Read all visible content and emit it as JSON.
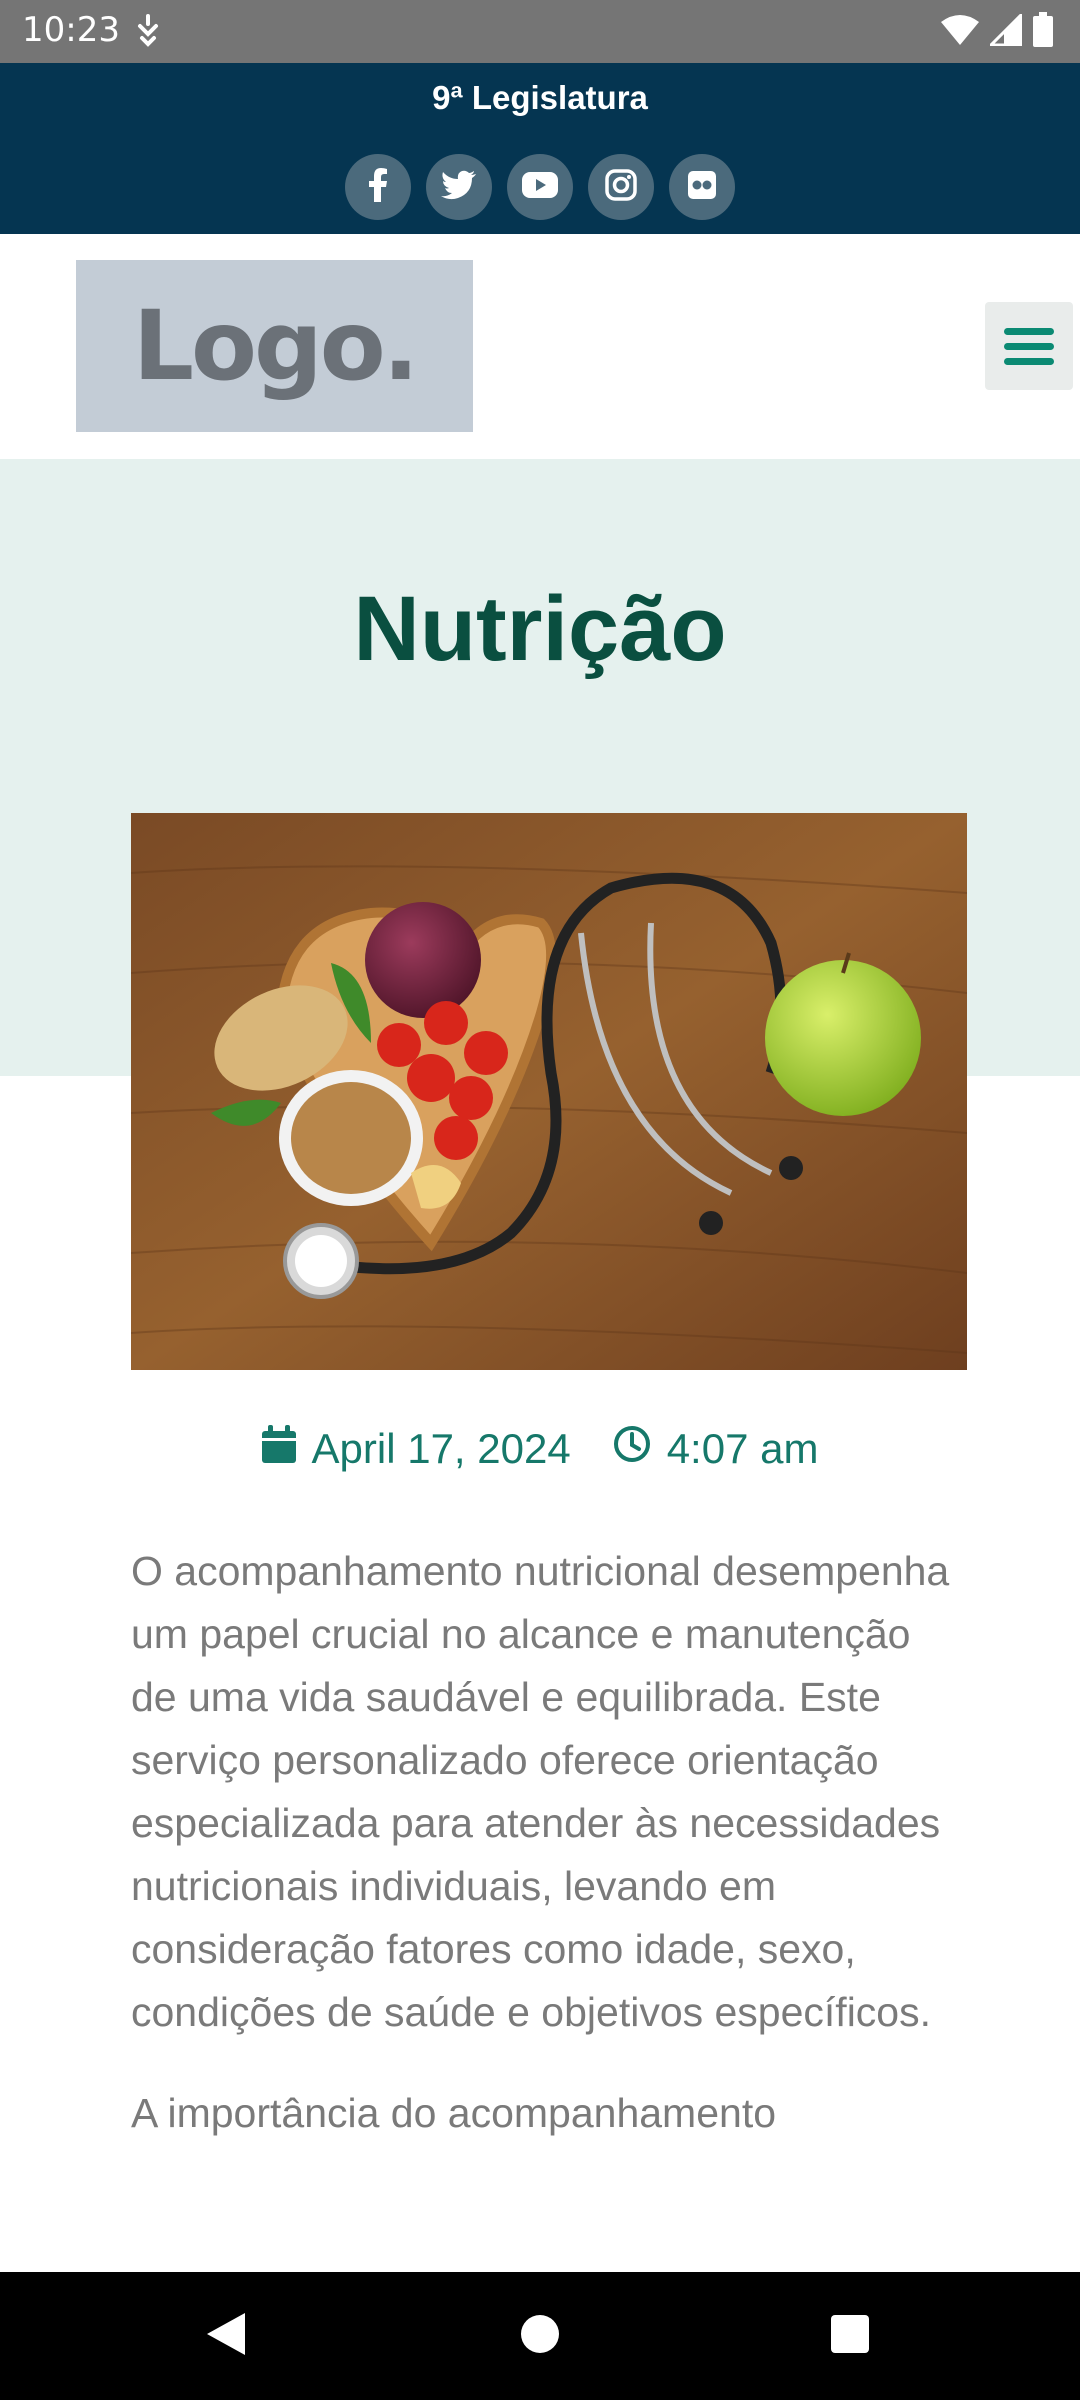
{
  "status_bar": {
    "time": "10:23"
  },
  "top_bar": {
    "legislatura": "9ª Legislatura",
    "social": [
      {
        "name": "facebook-icon"
      },
      {
        "name": "twitter-icon"
      },
      {
        "name": "youtube-icon"
      },
      {
        "name": "instagram-icon"
      },
      {
        "name": "flickr-icon"
      }
    ]
  },
  "header": {
    "logo_text": "Logo.",
    "menu_icon": "hamburger-icon"
  },
  "page": {
    "title": "Nutrição",
    "featured_image": "nutrition-heart-stethoscope-photo",
    "date": "April 17, 2024",
    "time": "4:07 am",
    "paragraphs": [
      "O acompanhamento nutricional desempenha um papel crucial no alcance e manutenção de uma vida saudável e equilibrada. Este serviço personalizado oferece orientação especializada para atender às necessidades nutricionais individuais, levando em consideração fatores como idade, sexo, condições de saúde e objetivos específicos.",
      "A importância do acompanhamento"
    ]
  },
  "colors": {
    "top_bar_bg": "#053551",
    "title": "#0a4f40",
    "accent": "#16786a",
    "hero_bg": "#e5f1ee",
    "body_text": "#7a7a7a"
  }
}
